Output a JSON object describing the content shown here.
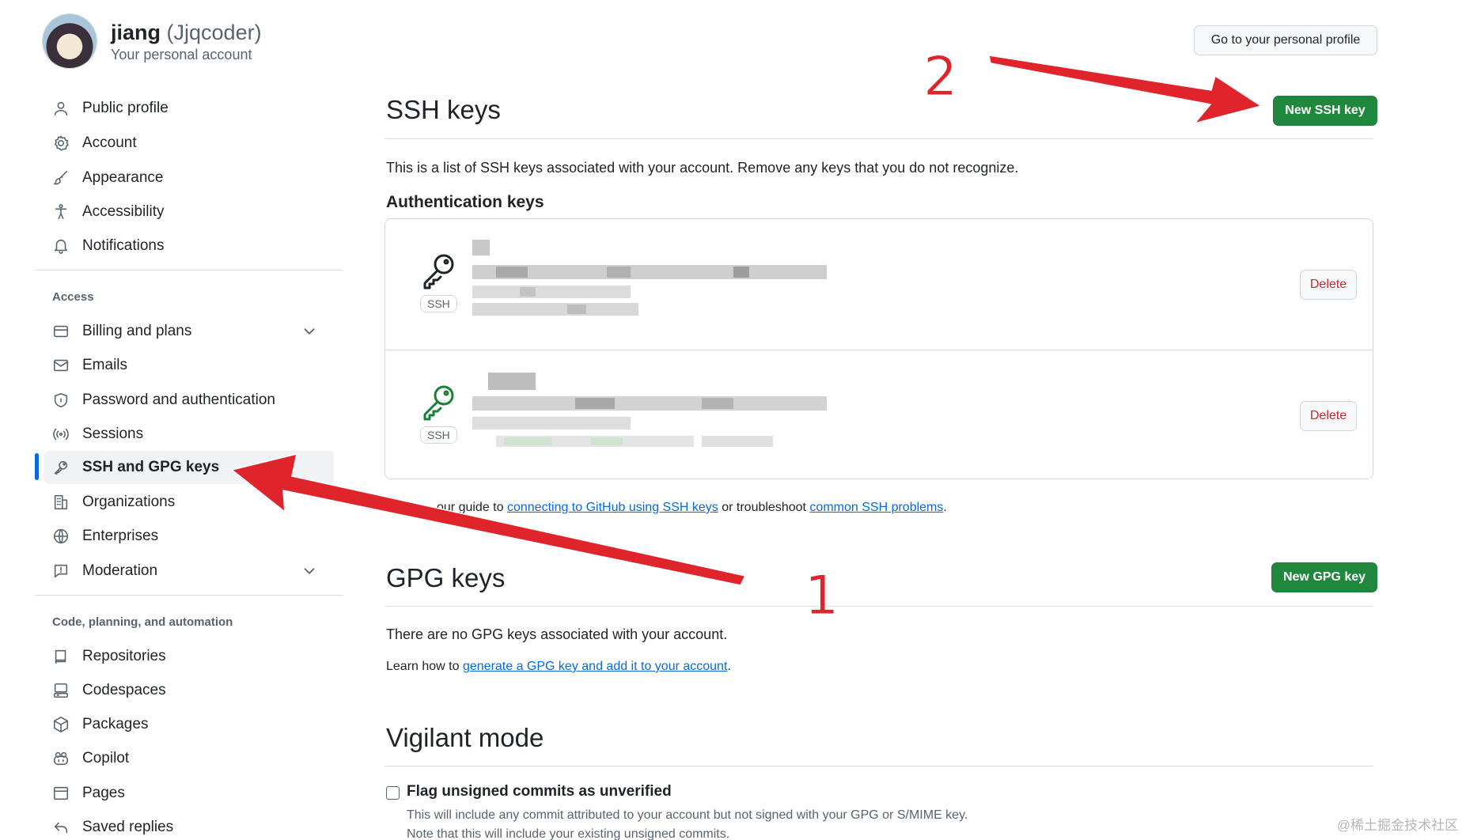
{
  "user": {
    "name": "jiang",
    "login": "(Jjqcoder)",
    "subtitle": "Your personal account"
  },
  "profile_button": "Go to your personal profile",
  "sidebar": {
    "items": [
      {
        "label": "Public profile",
        "icon": "person-icon"
      },
      {
        "label": "Account",
        "icon": "gear-icon"
      },
      {
        "label": "Appearance",
        "icon": "paintbrush-icon"
      },
      {
        "label": "Accessibility",
        "icon": "accessibility-icon"
      },
      {
        "label": "Notifications",
        "icon": "bell-icon"
      }
    ],
    "access_label": "Access",
    "access_items": [
      {
        "label": "Billing and plans",
        "icon": "credit-card-icon",
        "expandable": true
      },
      {
        "label": "Emails",
        "icon": "mail-icon"
      },
      {
        "label": "Password and authentication",
        "icon": "shield-icon"
      },
      {
        "label": "Sessions",
        "icon": "broadcast-icon"
      },
      {
        "label": "SSH and GPG keys",
        "icon": "key-icon",
        "active": true
      },
      {
        "label": "Organizations",
        "icon": "organization-icon"
      },
      {
        "label": "Enterprises",
        "icon": "globe-icon"
      },
      {
        "label": "Moderation",
        "icon": "report-icon",
        "expandable": true
      }
    ],
    "code_label": "Code, planning, and automation",
    "code_items": [
      {
        "label": "Repositories",
        "icon": "repo-icon"
      },
      {
        "label": "Codespaces",
        "icon": "codespaces-icon"
      },
      {
        "label": "Packages",
        "icon": "package-icon"
      },
      {
        "label": "Copilot",
        "icon": "copilot-icon"
      },
      {
        "label": "Pages",
        "icon": "browser-icon"
      },
      {
        "label": "Saved replies",
        "icon": "reply-icon"
      }
    ]
  },
  "ssh": {
    "title": "SSH keys",
    "new_button": "New SSH key",
    "description": "This is a list of SSH keys associated with your account. Remove any keys that you do not recognize.",
    "auth_heading": "Authentication keys",
    "keys": [
      {
        "badge": "SSH",
        "delete": "Delete",
        "icon_color": "#1f2328"
      },
      {
        "badge": "SSH",
        "delete": "Delete",
        "icon_color": "#1a7f37"
      }
    ],
    "guide_prefix": "…our guide to",
    "guide_link1": "connecting to GitHub using SSH keys",
    "guide_mid": "or troubleshoot",
    "guide_link2": "common SSH problems",
    "guide_end": "."
  },
  "gpg": {
    "title": "GPG keys",
    "new_button": "New GPG key",
    "empty": "There are no GPG keys associated with your account.",
    "learn_prefix": "Learn how to",
    "learn_link": "generate a GPG key and add it to your account",
    "learn_end": "."
  },
  "vigilant": {
    "title": "Vigilant mode",
    "checkbox_label": "Flag unsigned commits as unverified",
    "desc1": "This will include any commit attributed to your account but not signed with your GPG or S/MIME key.",
    "desc2": "Note that this will include your existing unsigned commits."
  },
  "annotations": {
    "one": "1",
    "two": "2",
    "arrow_color": "#e0242b"
  },
  "watermark": "@稀土掘金技术社区"
}
